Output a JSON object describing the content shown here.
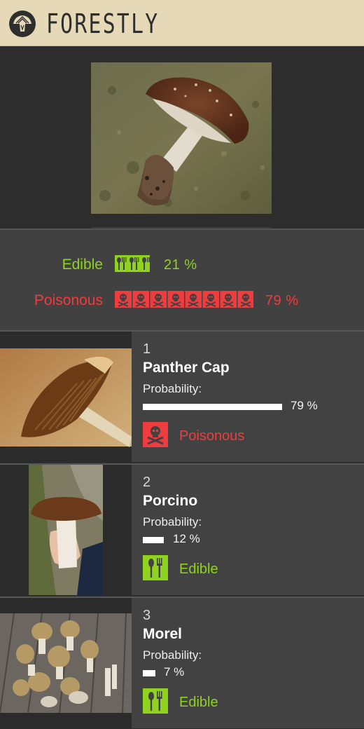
{
  "app": {
    "brand": "FORESTLY",
    "logo_icon": "mushroom-logo-icon"
  },
  "colors": {
    "header_bg": "#e6d9b8",
    "edible": "#8fd21f",
    "poisonous": "#ef3c3e",
    "panel": "#414141"
  },
  "hero": {
    "image": "photo of a brown-capped mushroom on mossy ground"
  },
  "summary": {
    "edible": {
      "label": "Edible",
      "percent_text": "21 %",
      "value": 21,
      "icon": "fork-spoon-icon"
    },
    "poisonous": {
      "label": "Poisonous",
      "percent_text": "79 %",
      "value": 79,
      "icon": "skull-crossbones-icon"
    }
  },
  "results": [
    {
      "rank": "1",
      "name": "Panther Cap",
      "probability_label": "Probability:",
      "probability": 79,
      "percent_text": "79 %",
      "classification": "Poisonous",
      "class_icon": "skull-crossbones-icon"
    },
    {
      "rank": "2",
      "name": "Porcino",
      "probability_label": "Probability:",
      "probability": 12,
      "percent_text": "12 %",
      "classification": "Edible",
      "class_icon": "fork-spoon-icon"
    },
    {
      "rank": "3",
      "name": "Morel",
      "probability_label": "Probability:",
      "probability": 7,
      "percent_text": "7 %",
      "classification": "Edible",
      "class_icon": "fork-spoon-icon"
    }
  ]
}
